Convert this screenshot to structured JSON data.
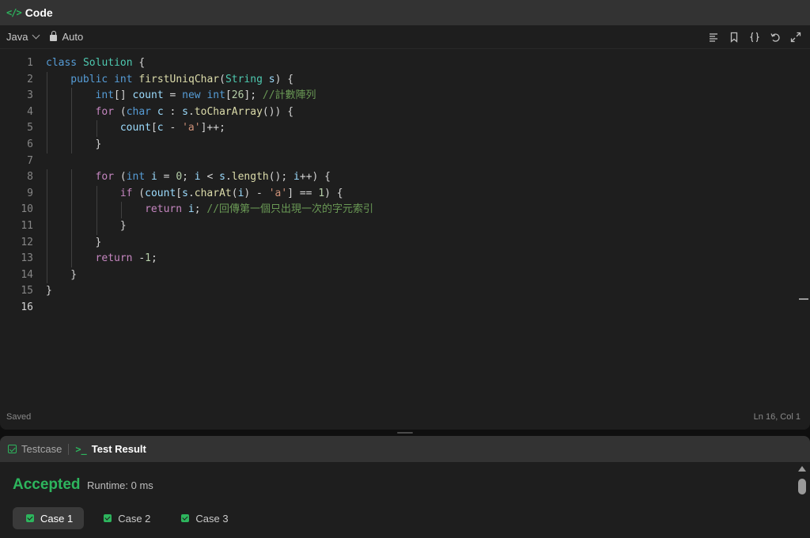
{
  "code_panel": {
    "tab_title": "Code",
    "code_icon": "</>",
    "language": "Java",
    "mode": "Auto",
    "toolbar_icons": [
      "format-lines-icon",
      "bookmark-icon",
      "braces-icon",
      "undo-icon",
      "expand-icon"
    ],
    "status_left": "Saved",
    "status_right": "Ln 16, Col 1",
    "active_line": 16
  },
  "result_panel": {
    "tabs": [
      {
        "label": "Testcase",
        "icon": "checkbox-icon",
        "active": false
      },
      {
        "label": "Test Result",
        "icon": "terminal-icon",
        "terminal_glyph": ">_",
        "active": true
      }
    ],
    "status": "Accepted",
    "runtime": "Runtime: 0 ms",
    "cases": [
      {
        "label": "Case 1",
        "selected": true
      },
      {
        "label": "Case 2",
        "selected": false
      },
      {
        "label": "Case 3",
        "selected": false
      }
    ]
  },
  "colors": {
    "accent_green": "#2db55d",
    "editor_bg": "#1e1e1e",
    "tabbar_bg": "#333333"
  },
  "code_lines": [
    {
      "num": "1",
      "indent": 0,
      "tokens": [
        [
          "k",
          "class"
        ],
        [
          "p",
          " "
        ],
        [
          "t",
          "Solution"
        ],
        [
          "p",
          " {"
        ]
      ]
    },
    {
      "num": "2",
      "indent": 1,
      "tokens": [
        [
          "k",
          "public"
        ],
        [
          "p",
          " "
        ],
        [
          "k",
          "int"
        ],
        [
          "p",
          " "
        ],
        [
          "f",
          "firstUniqChar"
        ],
        [
          "p",
          "("
        ],
        [
          "t",
          "String"
        ],
        [
          "p",
          " "
        ],
        [
          "v",
          "s"
        ],
        [
          "p",
          ") {"
        ]
      ]
    },
    {
      "num": "3",
      "indent": 2,
      "tokens": [
        [
          "k",
          "int"
        ],
        [
          "p",
          "[] "
        ],
        [
          "v",
          "count"
        ],
        [
          "p",
          " = "
        ],
        [
          "k",
          "new"
        ],
        [
          "p",
          " "
        ],
        [
          "k",
          "int"
        ],
        [
          "p",
          "["
        ],
        [
          "n",
          "26"
        ],
        [
          "p",
          "]; "
        ],
        [
          "c",
          "//計數陣列"
        ]
      ]
    },
    {
      "num": "4",
      "indent": 2,
      "tokens": [
        [
          "kc",
          "for"
        ],
        [
          "p",
          " ("
        ],
        [
          "k",
          "char"
        ],
        [
          "p",
          " "
        ],
        [
          "v",
          "c"
        ],
        [
          "p",
          " : "
        ],
        [
          "v",
          "s"
        ],
        [
          "p",
          "."
        ],
        [
          "f",
          "toCharArray"
        ],
        [
          "p",
          "()) {"
        ]
      ]
    },
    {
      "num": "5",
      "indent": 3,
      "tokens": [
        [
          "v",
          "count"
        ],
        [
          "p",
          "["
        ],
        [
          "v",
          "c"
        ],
        [
          "p",
          " - "
        ],
        [
          "s",
          "'a'"
        ],
        [
          "p",
          "]++;"
        ]
      ]
    },
    {
      "num": "6",
      "indent": 2,
      "tokens": [
        [
          "p",
          "}"
        ]
      ]
    },
    {
      "num": "7",
      "indent": 0,
      "tokens": []
    },
    {
      "num": "8",
      "indent": 2,
      "tokens": [
        [
          "kc",
          "for"
        ],
        [
          "p",
          " ("
        ],
        [
          "k",
          "int"
        ],
        [
          "p",
          " "
        ],
        [
          "v",
          "i"
        ],
        [
          "p",
          " = "
        ],
        [
          "n",
          "0"
        ],
        [
          "p",
          "; "
        ],
        [
          "v",
          "i"
        ],
        [
          "p",
          " < "
        ],
        [
          "v",
          "s"
        ],
        [
          "p",
          "."
        ],
        [
          "f",
          "length"
        ],
        [
          "p",
          "(); "
        ],
        [
          "v",
          "i"
        ],
        [
          "p",
          "++) {"
        ]
      ]
    },
    {
      "num": "9",
      "indent": 3,
      "tokens": [
        [
          "kc",
          "if"
        ],
        [
          "p",
          " ("
        ],
        [
          "v",
          "count"
        ],
        [
          "p",
          "["
        ],
        [
          "v",
          "s"
        ],
        [
          "p",
          "."
        ],
        [
          "f",
          "charAt"
        ],
        [
          "p",
          "("
        ],
        [
          "v",
          "i"
        ],
        [
          "p",
          ") - "
        ],
        [
          "s",
          "'a'"
        ],
        [
          "p",
          "] == "
        ],
        [
          "n",
          "1"
        ],
        [
          "p",
          ") {"
        ]
      ]
    },
    {
      "num": "10",
      "indent": 4,
      "tokens": [
        [
          "kc",
          "return"
        ],
        [
          "p",
          " "
        ],
        [
          "v",
          "i"
        ],
        [
          "p",
          "; "
        ],
        [
          "c",
          "//回傳第一個只出現一次的字元索引"
        ]
      ]
    },
    {
      "num": "11",
      "indent": 3,
      "tokens": [
        [
          "p",
          "}"
        ]
      ]
    },
    {
      "num": "12",
      "indent": 2,
      "tokens": [
        [
          "p",
          "}"
        ]
      ]
    },
    {
      "num": "13",
      "indent": 2,
      "tokens": [
        [
          "kc",
          "return"
        ],
        [
          "p",
          " -"
        ],
        [
          "n",
          "1"
        ],
        [
          "p",
          ";"
        ]
      ]
    },
    {
      "num": "14",
      "indent": 1,
      "tokens": [
        [
          "p",
          "}"
        ]
      ]
    },
    {
      "num": "15",
      "indent": 0,
      "tokens": [
        [
          "p",
          "}"
        ]
      ]
    },
    {
      "num": "16",
      "indent": 0,
      "tokens": []
    }
  ]
}
